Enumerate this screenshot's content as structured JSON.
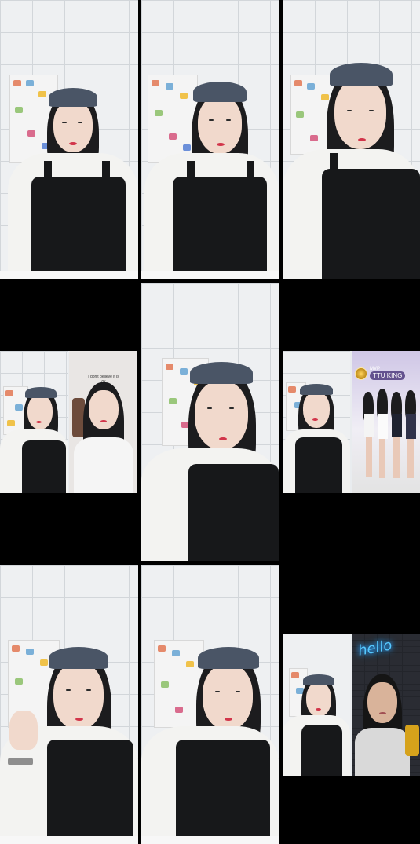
{
  "grid": {
    "panels": [
      {
        "id": "p1",
        "type": "solo"
      },
      {
        "id": "p2",
        "type": "solo"
      },
      {
        "id": "p3",
        "type": "solo"
      },
      {
        "id": "p4",
        "type": "duet"
      },
      {
        "id": "p5",
        "type": "solo"
      },
      {
        "id": "p6",
        "type": "duet"
      },
      {
        "id": "p7",
        "type": "solo"
      },
      {
        "id": "p8",
        "type": "solo"
      },
      {
        "id": "p9",
        "type": "duet"
      }
    ]
  },
  "duet_p4": {
    "caption": "I don't believe it is ok"
  },
  "duet_p6": {
    "badge_small": "MVP",
    "badge_label": "TTU KING"
  },
  "duet_p9": {
    "neon_sign": "hello"
  },
  "colors": {
    "background": "#000000",
    "apron": "#17181a",
    "cap": "#4a5566",
    "neon": "#55c8ff"
  }
}
